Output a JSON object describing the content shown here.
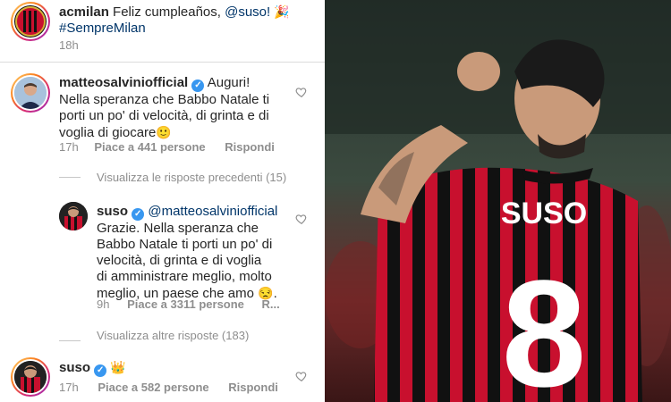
{
  "post": {
    "username": "acmilan",
    "caption": "Feliz cumpleaños,",
    "mention": "@suso!",
    "emoji": "🎉",
    "hashtag": "#SempreMilan",
    "time": "18h"
  },
  "comment_salvini": {
    "username": "matteosalviniofficial",
    "line1": "Auguri!",
    "line2": "Nella speranza che Babbo Natale ti",
    "line3": "porti un po' di velocità, di grinta e di",
    "line4": "voglia di giocare",
    "emoji": "🙂",
    "time": "17h",
    "likes": "Piace a 441 persone",
    "reply": "Rispondi"
  },
  "view_previous": "Visualizza le risposte precedenti (15)",
  "reply_suso": {
    "username": "suso",
    "mention": "@matteosalviniofficial",
    "line1": "Grazie. Nella speranza che",
    "line2": "Babbo Natale ti porti un po' di",
    "line3": "velocità, di grinta e di voglia",
    "line4": "di amministrare meglio, molto",
    "line5": "meglio, un paese che amo",
    "emoji": "😒",
    "time": "9h",
    "likes": "Piace a 3311 persone",
    "reply": "R..."
  },
  "view_more": "Visualizza altre risposte (183)",
  "comment_suso": {
    "username": "suso",
    "emoji": "👑",
    "time": "17h",
    "likes": "Piace a 582 persone",
    "reply": "Rispondi"
  },
  "photo": {
    "jersey_name": "SUSO",
    "jersey_number": "8"
  },
  "colors": {
    "verified": "#3897f0",
    "milan_red": "#c8102e",
    "milan_black": "#111111"
  }
}
